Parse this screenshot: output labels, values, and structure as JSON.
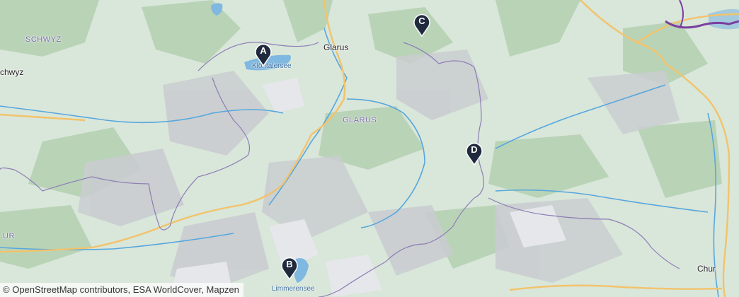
{
  "map": {
    "colors": {
      "base": "#d9e6da",
      "forest": "#b9d3b7",
      "mountain": "#c9ccd0",
      "rock": "#e6e7ea",
      "water": "#7fb8e0",
      "river": "#56a7de",
      "road": "#f2c36b",
      "border": "#8d7db5",
      "marker": "#1f2a3d"
    },
    "places": {
      "schwyz_region": "SCHWYZ",
      "schwyz_town": "chwyz",
      "glarus_town": "Glarus",
      "glarus_region": "GLARUS",
      "uri_region": "UR",
      "chur": "Chur",
      "kloentalersee": "Klöntalersee",
      "limmerensee": "Limmerensee"
    },
    "markers": [
      {
        "letter": "A"
      },
      {
        "letter": "B"
      },
      {
        "letter": "C"
      },
      {
        "letter": "D"
      }
    ],
    "attribution": {
      "symbol": "©",
      "text": "OpenStreetMap contributors, ESA WorldCover, Mapzen"
    }
  }
}
